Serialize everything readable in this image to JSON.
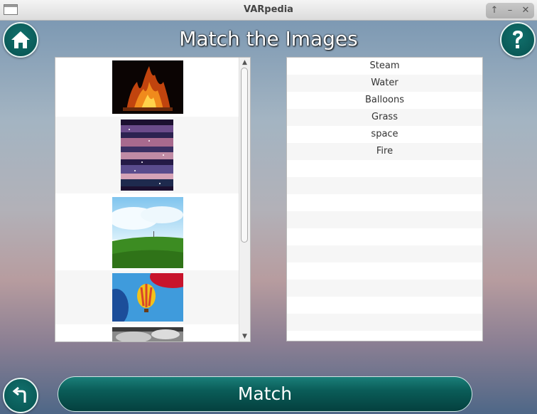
{
  "window": {
    "title": "VARpedia",
    "controls": [
      "↑",
      "–",
      "✕"
    ]
  },
  "header": {
    "title": "Match the Images"
  },
  "left_list": {
    "items": [
      {
        "image": "fire-photo"
      },
      {
        "image": "space-nebula-collage"
      },
      {
        "image": "grass-field-sky-photo"
      },
      {
        "image": "hot-air-balloons-photo"
      },
      {
        "image": "steam-photo-partial"
      }
    ]
  },
  "right_list": {
    "items": [
      "Steam",
      "Water",
      "Balloons",
      "Grass",
      "space",
      "Fire"
    ]
  },
  "buttons": {
    "match_label": "Match"
  },
  "colors": {
    "accent": "#0a5c58",
    "button_border": "#e7f3f2"
  }
}
